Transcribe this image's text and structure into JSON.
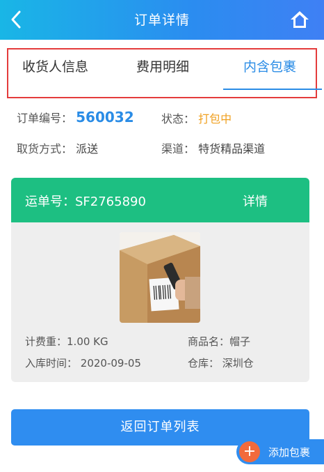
{
  "header": {
    "title": "订单详情",
    "back_icon": "chevron-left-icon",
    "home_icon": "home-icon"
  },
  "tabs": [
    {
      "label": "收货人信息",
      "active": false
    },
    {
      "label": "费用明细",
      "active": false
    },
    {
      "label": "内含包裹",
      "active": true
    }
  ],
  "order": {
    "number_label": "订单编号：",
    "number": "560032",
    "status_label": "状态：",
    "status": "打包中",
    "pickup_label": "取货方式：",
    "pickup": "派送",
    "channel_label": "渠道：",
    "channel": "特货精品渠道"
  },
  "package": {
    "waybill_label": "运单号：",
    "waybill": "SF2765890",
    "detail_label": "详情",
    "weight_label": "计费重：",
    "weight": "1.00 KG",
    "product_label": "商品名：",
    "product": "帽子",
    "inbound_label": "入库时间：",
    "inbound_date": "2020-09-05",
    "warehouse_label": "仓库：",
    "warehouse": "深圳仓"
  },
  "buttons": {
    "return": "返回订单列表",
    "add_package": "添加包裹",
    "add_icon": "plus-icon"
  },
  "colors": {
    "header_start": "#19b6e6",
    "header_end": "#3f80f4",
    "accent_blue": "#2a8ce6",
    "status_orange": "#f0a020",
    "card_green": "#1dbf82",
    "highlight_red": "#e43b3b",
    "add_orange": "#f26a3c"
  }
}
